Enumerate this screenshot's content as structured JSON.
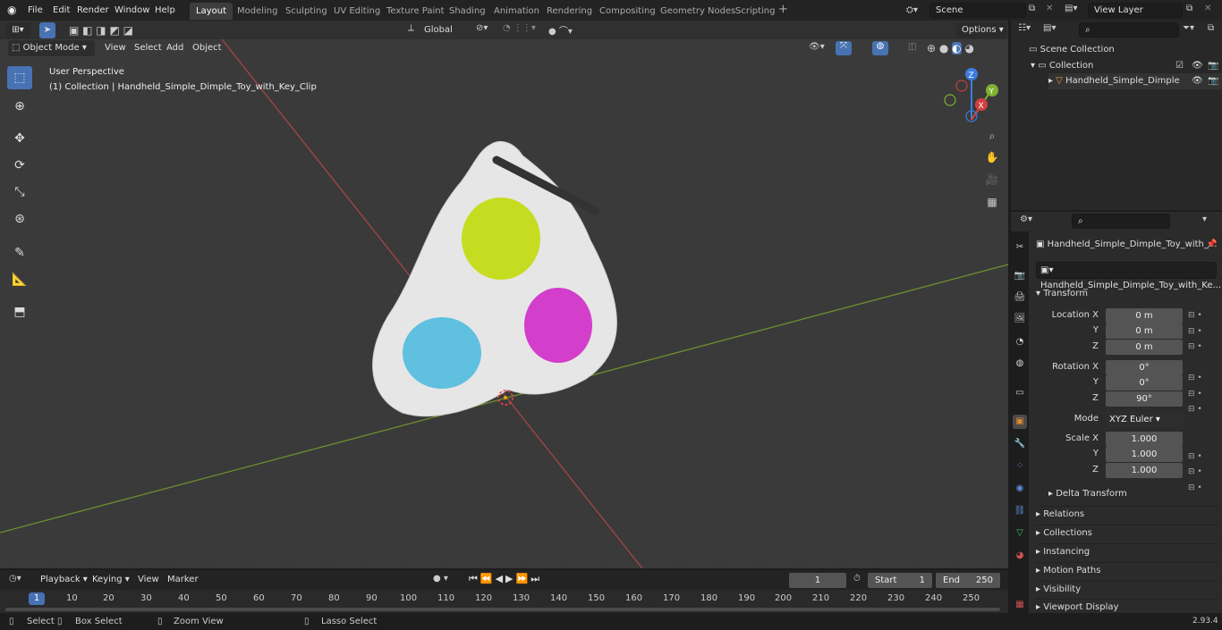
{
  "topbar": {
    "menus": [
      "File",
      "Edit",
      "Render",
      "Window",
      "Help"
    ],
    "workspaces": [
      "Layout",
      "Modeling",
      "Sculpting",
      "UV Editing",
      "Texture Paint",
      "Shading",
      "Animation",
      "Rendering",
      "Compositing",
      "Geometry Nodes",
      "Scripting"
    ],
    "active_workspace": "Layout",
    "scene": "Scene",
    "view_layer": "View Layer"
  },
  "viewport_header": {
    "mode": "Object Mode",
    "menus": [
      "View",
      "Select",
      "Add",
      "Object"
    ],
    "orientation": "Global",
    "options": "Options"
  },
  "viewport": {
    "perspective": "User Perspective",
    "collection_info": "(1) Collection | Handheld_Simple_Dimple_Toy_with_Key_Clip",
    "gizmo_axes": [
      "Z",
      "Y",
      "X"
    ],
    "colors": {
      "x_axis": "#c94b4b",
      "y_axis": "#7fa33a",
      "background": "#3a3a3a",
      "lime": "#c8e020",
      "magenta": "#d33ed0",
      "cyan": "#57bde0",
      "body": "#e8e8e8"
    }
  },
  "outliner": {
    "scene_collection": "Scene Collection",
    "collection": "Collection",
    "object": "Handheld_Simple_Dimple"
  },
  "properties": {
    "object_name": "Handheld_Simple_Dimple_Toy_with_...",
    "data_name": "Handheld_Simple_Dimple_Toy_with_Ke...",
    "transform_header": "Transform",
    "location_label": "Location X",
    "rotation_label": "Rotation X",
    "scale_label": "Scale X",
    "y_label": "Y",
    "z_label": "Z",
    "location": [
      "0 m",
      "0 m",
      "0 m"
    ],
    "rotation": [
      "0°",
      "0°",
      "90°"
    ],
    "mode_label": "Mode",
    "mode_value": "XYZ Euler",
    "scale": [
      "1.000",
      "1.000",
      "1.000"
    ],
    "delta": "Delta Transform",
    "sections": [
      "Relations",
      "Collections",
      "Instancing",
      "Motion Paths",
      "Visibility",
      "Viewport Display"
    ]
  },
  "timeline": {
    "menus": [
      "Playback",
      "Keying",
      "View",
      "Marker"
    ],
    "current_frame": "1",
    "start_label": "Start",
    "start": "1",
    "end_label": "End",
    "end": "250",
    "ruler": [
      "1",
      "10",
      "20",
      "30",
      "40",
      "50",
      "60",
      "70",
      "80",
      "90",
      "100",
      "110",
      "120",
      "130",
      "140",
      "150",
      "160",
      "170",
      "180",
      "190",
      "200",
      "210",
      "220",
      "230",
      "240",
      "250"
    ]
  },
  "statusbar": {
    "select": "Select",
    "box_select": "Box Select",
    "zoom_view": "Zoom View",
    "lasso_select": "Lasso Select",
    "version": "2.93.4"
  }
}
